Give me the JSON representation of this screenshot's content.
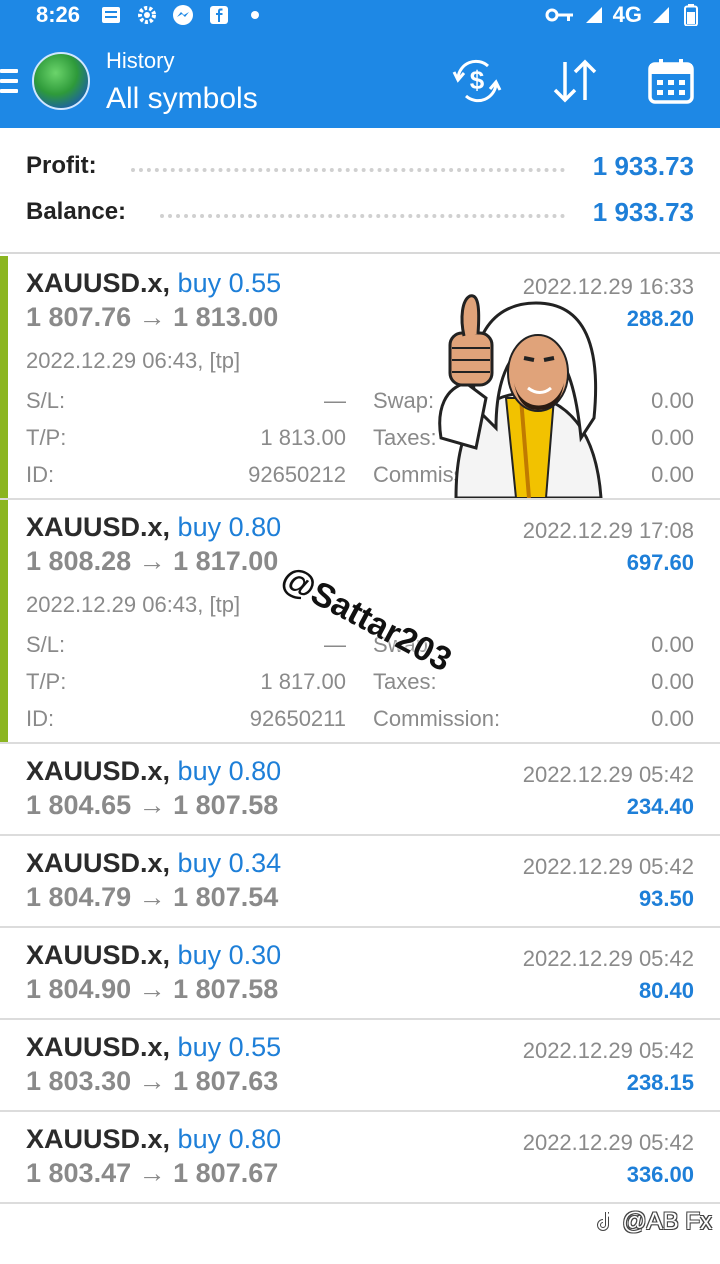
{
  "status_bar": {
    "time": "8:26",
    "network": "4G"
  },
  "header": {
    "subtitle": "History",
    "title": "All symbols"
  },
  "summary": {
    "profit_label": "Profit:",
    "profit_value": "1 933.73",
    "balance_label": "Balance:",
    "balance_value": "1 933.73"
  },
  "deals": [
    {
      "symbol": "XAUUSD.x,",
      "side": "buy 0.55",
      "open_price": "1 807.76",
      "close_price": "1 813.00",
      "time": "2022.12.29 16:33",
      "profit": "288.20",
      "opened": "2022.12.29 06:43, [tp]",
      "sl_label": "S/L:",
      "sl": "—",
      "tp_label": "T/P:",
      "tp": "1 813.00",
      "id_label": "ID:",
      "id": "92650212",
      "swap_label": "Swap:",
      "swap": "0.00",
      "taxes_label": "Taxes:",
      "taxes": "0.00",
      "commission_label": "Commission:",
      "commission": "0.00"
    },
    {
      "symbol": "XAUUSD.x,",
      "side": "buy 0.80",
      "open_price": "1 808.28",
      "close_price": "1 817.00",
      "time": "2022.12.29 17:08",
      "profit": "697.60",
      "opened": "2022.12.29 06:43, [tp]",
      "sl_label": "S/L:",
      "sl": "—",
      "tp_label": "T/P:",
      "tp": "1 817.00",
      "id_label": "ID:",
      "id": "92650211",
      "swap_label": "Swap:",
      "swap": "0.00",
      "taxes_label": "Taxes:",
      "taxes": "0.00",
      "commission_label": "Commission:",
      "commission": "0.00"
    },
    {
      "symbol": "XAUUSD.x,",
      "side": "buy 0.80",
      "open_price": "1 804.65",
      "close_price": "1 807.58",
      "time": "2022.12.29 05:42",
      "profit": "234.40"
    },
    {
      "symbol": "XAUUSD.x,",
      "side": "buy 0.34",
      "open_price": "1 804.79",
      "close_price": "1 807.54",
      "time": "2022.12.29 05:42",
      "profit": "93.50"
    },
    {
      "symbol": "XAUUSD.x,",
      "side": "buy 0.30",
      "open_price": "1 804.90",
      "close_price": "1 807.58",
      "time": "2022.12.29 05:42",
      "profit": "80.40"
    },
    {
      "symbol": "XAUUSD.x,",
      "side": "buy 0.55",
      "open_price": "1 803.30",
      "close_price": "1 807.63",
      "time": "2022.12.29 05:42",
      "profit": "238.15"
    },
    {
      "symbol": "XAUUSD.x,",
      "side": "buy 0.80",
      "open_price": "1 803.47",
      "close_price": "1 807.67",
      "time": "2022.12.29 05:42",
      "profit": "336.00"
    }
  ],
  "arrow": "→",
  "overlays": {
    "handle": "@Sattar203",
    "footer": "@AB Fx"
  },
  "colors": {
    "accent": "#1e88e5",
    "profit": "#1e7fd8",
    "expanded_marker": "#8bb521"
  }
}
